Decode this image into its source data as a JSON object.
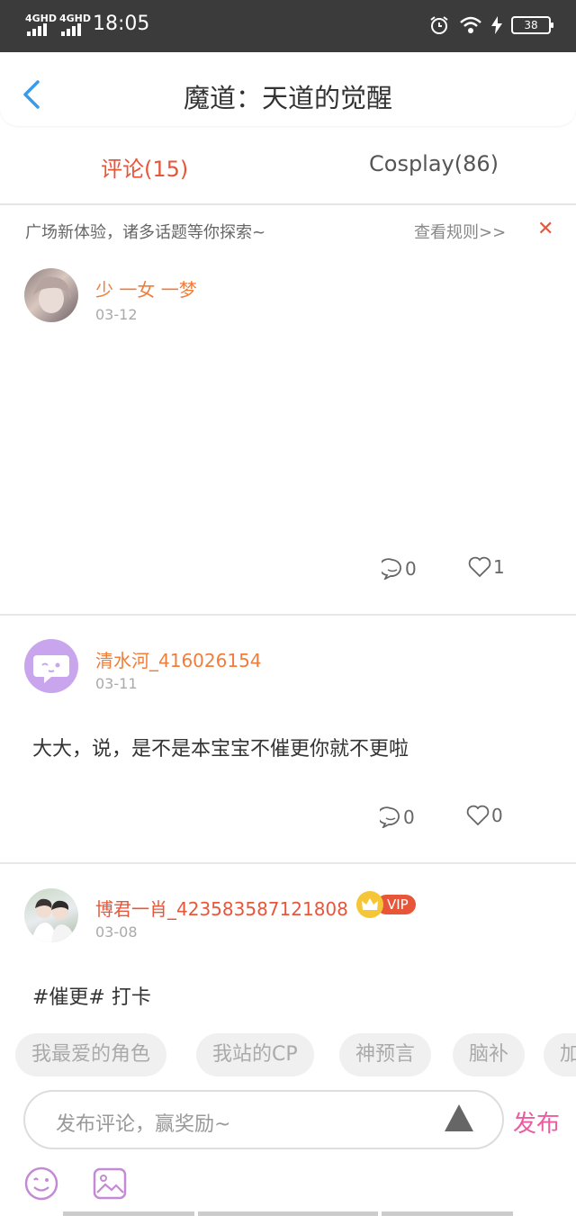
{
  "status_bar": {
    "signal_1": "4GHD",
    "signal_2": "4GHD",
    "time": "18:05",
    "battery": "38"
  },
  "header": {
    "title": "魔道：天道的觉醒"
  },
  "tabs": [
    {
      "label": "评论(15)",
      "active": true
    },
    {
      "label": "Cosplay(86)",
      "active": false
    }
  ],
  "notice": {
    "text": "广场新体验，诸多话题等你探索~",
    "rules_link": "查看规则>>",
    "close": "✕"
  },
  "posts": [
    {
      "username": "少 一女 一梦",
      "date": "03-12",
      "content": "",
      "comments": "0",
      "likes": "1"
    },
    {
      "username": "清水河_416026154",
      "date": "03-11",
      "content": "大大，说，是不是本宝宝不催更你就不更啦",
      "comments": "0",
      "likes": "0"
    },
    {
      "username": "博君一肖_423583587121808",
      "date": "03-08",
      "content": "#催更# 打卡",
      "vip_label": "VIP"
    }
  ],
  "topic_chips": [
    "我最爱的角色",
    "我站的CP",
    "神预言",
    "脑补",
    "加"
  ],
  "composer": {
    "placeholder": "发布评论，赢奖励~",
    "send_label": "发布"
  },
  "colors": {
    "accent": "#e8563a",
    "username": "#f07d3b",
    "send": "#ee5aa0",
    "bottom_icons": "#c58ad6"
  }
}
